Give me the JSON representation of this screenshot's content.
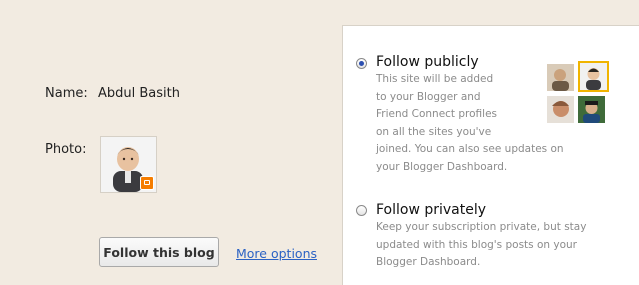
{
  "profile": {
    "name_label": "Name:",
    "name_value": "Abdul Basith",
    "photo_label": "Photo:"
  },
  "actions": {
    "follow_button": "Follow this blog",
    "more_options": "More options"
  },
  "follow_options": {
    "public": {
      "title": "Follow publicly",
      "description": "This site will be added\nto your Blogger and\nFriend Connect profiles\non all the sites you've\njoined. You can also see updates on\nyour Blogger Dashboard.",
      "selected": true
    },
    "private": {
      "title": "Follow privately",
      "description": "Keep your subscription private, but stay\nupdated with this blog's posts on your\nBlogger Dashboard.",
      "selected": false
    }
  },
  "colors": {
    "page_bg": "#f2ebe1",
    "link": "#2b62c4",
    "blogger_orange": "#f57d00",
    "highlight": "#f0b400"
  }
}
